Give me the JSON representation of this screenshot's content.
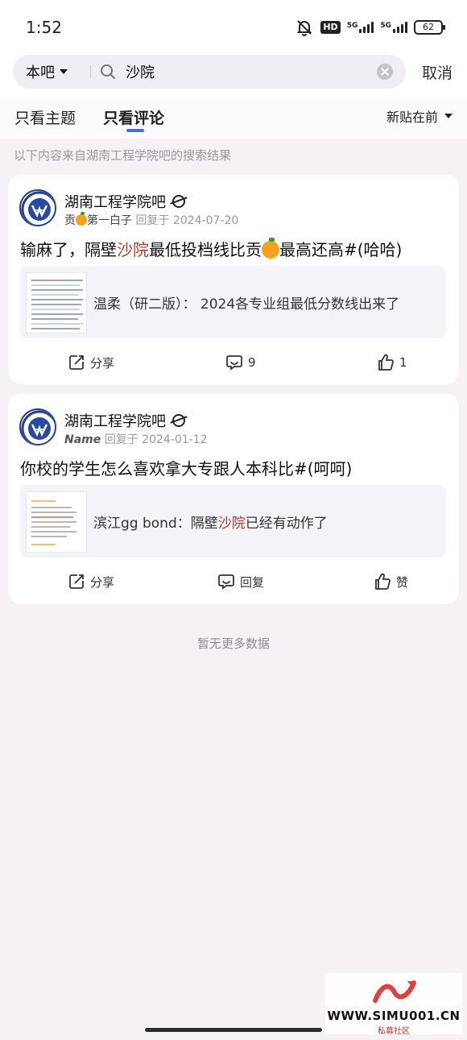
{
  "status_bar": {
    "time": "1:52",
    "hd_label": "HD",
    "net1_label": "5G",
    "net2_label": "5G",
    "battery": "62"
  },
  "search": {
    "scope": "本吧",
    "query": "沙院",
    "cancel_label": "取消"
  },
  "tabs": {
    "items": [
      "只看主题",
      "只看评论"
    ],
    "active_index": 1,
    "sort_label": "新贴在前"
  },
  "source_note": "以下内容来自湖南工程学院吧的搜索结果",
  "posts": [
    {
      "forum": "湖南工程学院吧",
      "author_prefix": "贡",
      "author_suffix": "第一白子",
      "reply_label": "回复于",
      "date": "2024-07-20",
      "title_part1": "输麻了，隔壁",
      "title_highlight": "沙院",
      "title_part2": "最低投档线比贡",
      "title_part3": "最高还高#(哈哈)",
      "quote_text": "温柔（研二版）：  2024各专业组最低分数线出来了",
      "share_label": "分享",
      "comment_label": "9",
      "like_label": "1"
    },
    {
      "forum": "湖南工程学院吧",
      "author": "Name",
      "reply_label": "回复于",
      "date": "2024-01-12",
      "title": "你校的学生怎么喜欢拿大专跟人本科比#(呵呵)",
      "quote_part1": "滨江gg bond：隔壁",
      "quote_highlight": "沙院",
      "quote_part2": "已经有动作了",
      "share_label": "分享",
      "comment_label": "回复",
      "like_label": "赞"
    }
  ],
  "no_more": "暂无更多数据",
  "watermark": {
    "url": "WWW.SIMU001.CN",
    "sub": "私募社区"
  },
  "colors": {
    "highlight": "#c8312c",
    "accent": "#3e6fe6",
    "background": "#f6f1f5"
  }
}
